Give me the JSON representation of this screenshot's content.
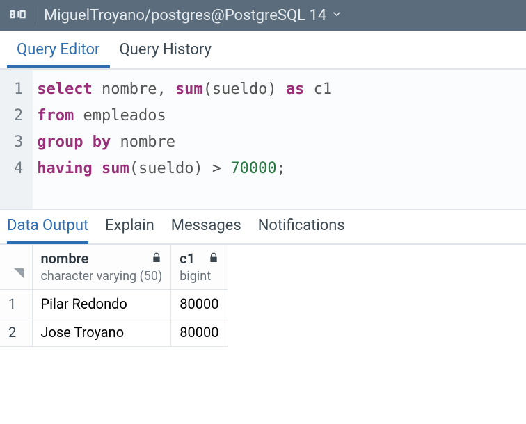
{
  "connection": {
    "label": "MiguelTroyano/postgres@PostgreSQL 14"
  },
  "editorTabs": {
    "queryEditor": "Query Editor",
    "queryHistory": "Query History",
    "active": "queryEditor"
  },
  "code": {
    "lines": [
      {
        "n": "1",
        "tokens": [
          {
            "t": "select ",
            "c": "kw"
          },
          {
            "t": "nombre, ",
            "c": "pn"
          },
          {
            "t": "sum",
            "c": "fn"
          },
          {
            "t": "(sueldo) ",
            "c": "pn"
          },
          {
            "t": "as ",
            "c": "kw"
          },
          {
            "t": "c1",
            "c": "pn"
          }
        ]
      },
      {
        "n": "2",
        "tokens": [
          {
            "t": "from ",
            "c": "kw"
          },
          {
            "t": "empleados",
            "c": "pn"
          }
        ]
      },
      {
        "n": "3",
        "tokens": [
          {
            "t": "group by ",
            "c": "kw"
          },
          {
            "t": "nombre",
            "c": "pn"
          }
        ]
      },
      {
        "n": "4",
        "tokens": [
          {
            "t": "having ",
            "c": "kw"
          },
          {
            "t": "sum",
            "c": "fn"
          },
          {
            "t": "(sueldo) > ",
            "c": "pn"
          },
          {
            "t": "70000",
            "c": "num"
          },
          {
            "t": ";",
            "c": "pn"
          }
        ]
      }
    ]
  },
  "resultTabs": {
    "dataOutput": "Data Output",
    "explain": "Explain",
    "messages": "Messages",
    "notifications": "Notifications",
    "active": "dataOutput"
  },
  "results": {
    "columns": [
      {
        "name": "nombre",
        "type": "character varying (50)"
      },
      {
        "name": "c1",
        "type": "bigint"
      }
    ],
    "rows": [
      {
        "n": "1",
        "nombre": "Pilar Redondo",
        "c1": "80000"
      },
      {
        "n": "2",
        "nombre": "Jose Troyano",
        "c1": "80000"
      }
    ]
  }
}
